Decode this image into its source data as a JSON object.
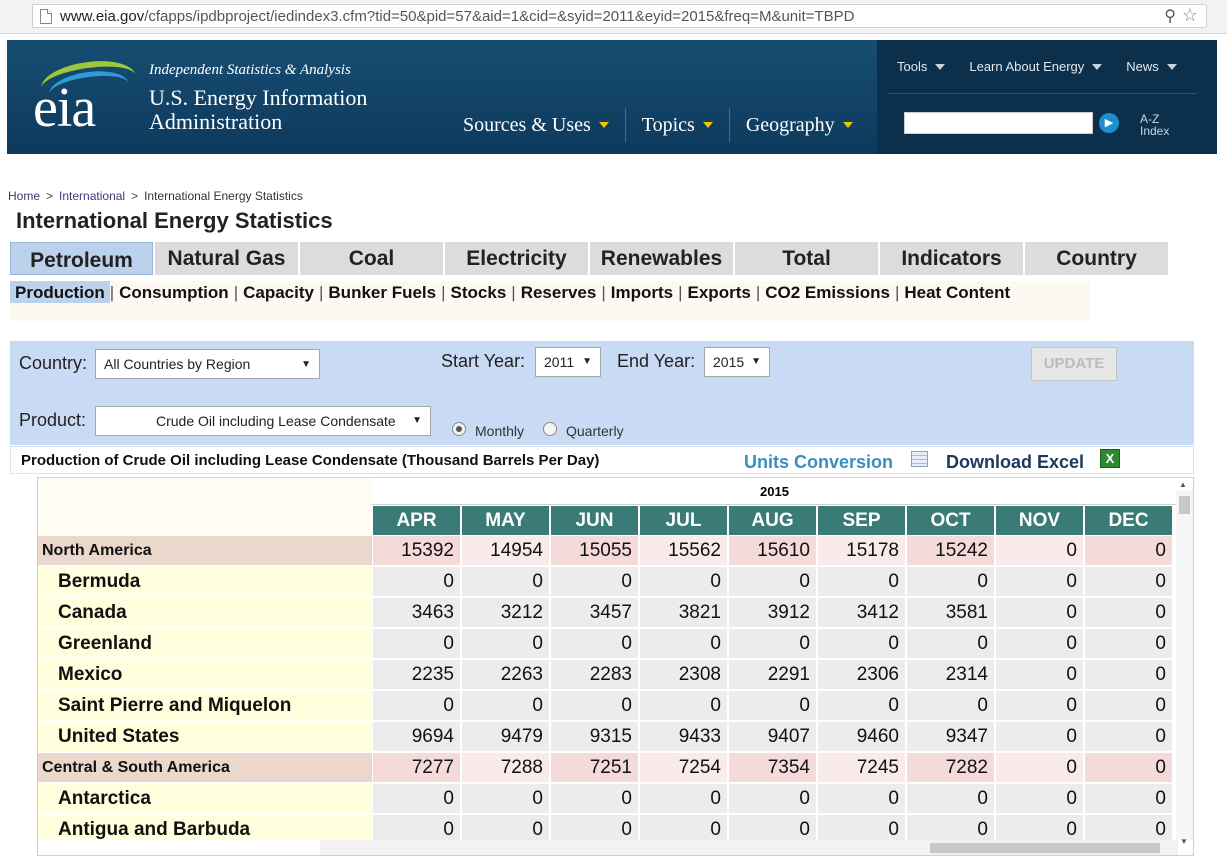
{
  "browser": {
    "url_host": "www.eia.gov",
    "url_path": "/cfapps/ipdbproject/iedindex3.cfm?tid=50&pid=57&aid=1&cid=&syid=2011&eyid=2015&freq=M&unit=TBPD"
  },
  "header": {
    "logo_text": "eia",
    "tagline": "Independent Statistics & Analysis",
    "org_line1": "U.S. Energy Information",
    "org_line2": "Administration",
    "nav": [
      "Sources & Uses",
      "Topics",
      "Geography"
    ],
    "top_links": [
      "Tools",
      "Learn About Energy",
      "News"
    ],
    "search_placeholder": "",
    "az_line1": "A-Z",
    "az_line2": "Index"
  },
  "breadcrumb": [
    "Home",
    "International",
    "International Energy Statistics"
  ],
  "page_title": "International Energy Statistics",
  "tabs": [
    "Petroleum",
    "Natural Gas",
    "Coal",
    "Electricity",
    "Renewables",
    "Total",
    "Indicators",
    "Country"
  ],
  "active_tab": "Petroleum",
  "subnav": [
    "Production",
    "Consumption",
    "Capacity",
    "Bunker Fuels",
    "Stocks",
    "Reserves",
    "Imports",
    "Exports",
    "CO2 Emissions",
    "Heat Content"
  ],
  "filters": {
    "country_label": "Country:",
    "country_value": "All Countries by Region",
    "start_label": "Start Year:",
    "start_value": "2011",
    "end_label": "End Year:",
    "end_value": "2015",
    "update_label": "UPDATE",
    "product_label": "Product:",
    "product_value": "Crude Oil including Lease Condensate",
    "freq_monthly": "Monthly",
    "freq_quarterly": "Quarterly",
    "freq_selected": "Monthly"
  },
  "table": {
    "caption": "Production of Crude Oil including Lease Condensate (Thousand Barrels Per Day)",
    "units_conversion": "Units Conversion",
    "download_excel": "Download Excel",
    "year": "2015",
    "months": [
      "APR",
      "MAY",
      "JUN",
      "JUL",
      "AUG",
      "SEP",
      "OCT",
      "NOV",
      "DEC"
    ],
    "rows": [
      {
        "name": "North America",
        "region": true,
        "values": [
          "15392",
          "14954",
          "15055",
          "15562",
          "15610",
          "15178",
          "15242",
          "0",
          "0"
        ]
      },
      {
        "name": "Bermuda",
        "region": false,
        "values": [
          "0",
          "0",
          "0",
          "0",
          "0",
          "0",
          "0",
          "0",
          "0"
        ]
      },
      {
        "name": "Canada",
        "region": false,
        "values": [
          "3463",
          "3212",
          "3457",
          "3821",
          "3912",
          "3412",
          "3581",
          "0",
          "0"
        ]
      },
      {
        "name": "Greenland",
        "region": false,
        "values": [
          "0",
          "0",
          "0",
          "0",
          "0",
          "0",
          "0",
          "0",
          "0"
        ]
      },
      {
        "name": "Mexico",
        "region": false,
        "values": [
          "2235",
          "2263",
          "2283",
          "2308",
          "2291",
          "2306",
          "2314",
          "0",
          "0"
        ]
      },
      {
        "name": "Saint Pierre and Miquelon",
        "region": false,
        "values": [
          "0",
          "0",
          "0",
          "0",
          "0",
          "0",
          "0",
          "0",
          "0"
        ]
      },
      {
        "name": "United States",
        "region": false,
        "values": [
          "9694",
          "9479",
          "9315",
          "9433",
          "9407",
          "9460",
          "9347",
          "0",
          "0"
        ]
      },
      {
        "name": "Central & South America",
        "region": true,
        "values": [
          "7277",
          "7288",
          "7251",
          "7254",
          "7354",
          "7245",
          "7282",
          "0",
          "0"
        ]
      },
      {
        "name": "Antarctica",
        "region": false,
        "values": [
          "0",
          "0",
          "0",
          "0",
          "0",
          "0",
          "0",
          "0",
          "0"
        ]
      },
      {
        "name": "Antigua and Barbuda",
        "region": false,
        "values": [
          "0",
          "0",
          "0",
          "0",
          "0",
          "0",
          "0",
          "0",
          "0"
        ]
      }
    ]
  },
  "colors": {
    "header_bg": "#174d73",
    "accent_caret": "#f5c400",
    "month_header": "#3a7a77",
    "region_row": "#ecd7cc",
    "filter_panel": "#c8daf4"
  }
}
